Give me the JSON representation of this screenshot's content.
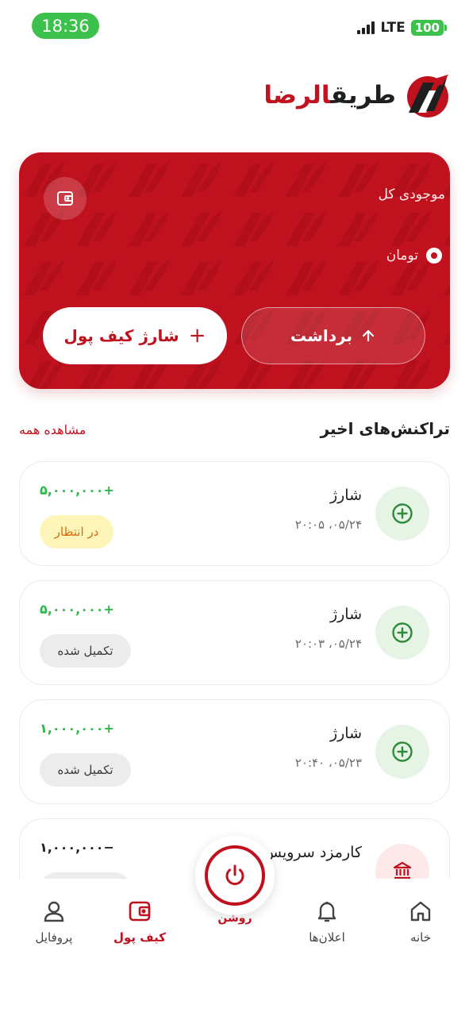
{
  "status_bar": {
    "time": "18:36",
    "network": "LTE",
    "battery": "100"
  },
  "brand": {
    "name_part1": "طریق",
    "name_part2": "الرضا"
  },
  "wallet": {
    "balance_label": "موجودی کل",
    "currency_label": "تومان",
    "charge_button": "شارژ کیف پول",
    "withdraw_button": "برداشت"
  },
  "transactions_section": {
    "title": "تراکنش‌های اخیر",
    "see_all": "مشاهده همه",
    "items": [
      {
        "title": "شارژ",
        "date": "۰۵/۲۴، ۲۰:۰۵",
        "amount": "+۵,۰۰۰,۰۰۰",
        "status": "در انتظار",
        "type": "credit"
      },
      {
        "title": "شارژ",
        "date": "۰۵/۲۴، ۲۰:۰۳",
        "amount": "+۵,۰۰۰,۰۰۰",
        "status": "تکمیل شده",
        "type": "credit"
      },
      {
        "title": "شارژ",
        "date": "۰۵/۲۳، ۲۰:۴۰",
        "amount": "+۱,۰۰۰,۰۰۰",
        "status": "تکمیل شده",
        "type": "credit"
      },
      {
        "title": "کارمزد سرویس",
        "amount": "−۱,۰۰۰,۰۰۰",
        "type": "debit"
      }
    ]
  },
  "bottom_nav": {
    "home": "خانه",
    "notifications": "اعلان‌ها",
    "power": "روشن",
    "wallet": "کیف پول",
    "profile": "پروفایل"
  },
  "colors": {
    "brand_red": "#c0111e",
    "success_green": "#2eb84a",
    "pending_bg": "#fdf6b8",
    "pending_text": "#d46a15"
  }
}
